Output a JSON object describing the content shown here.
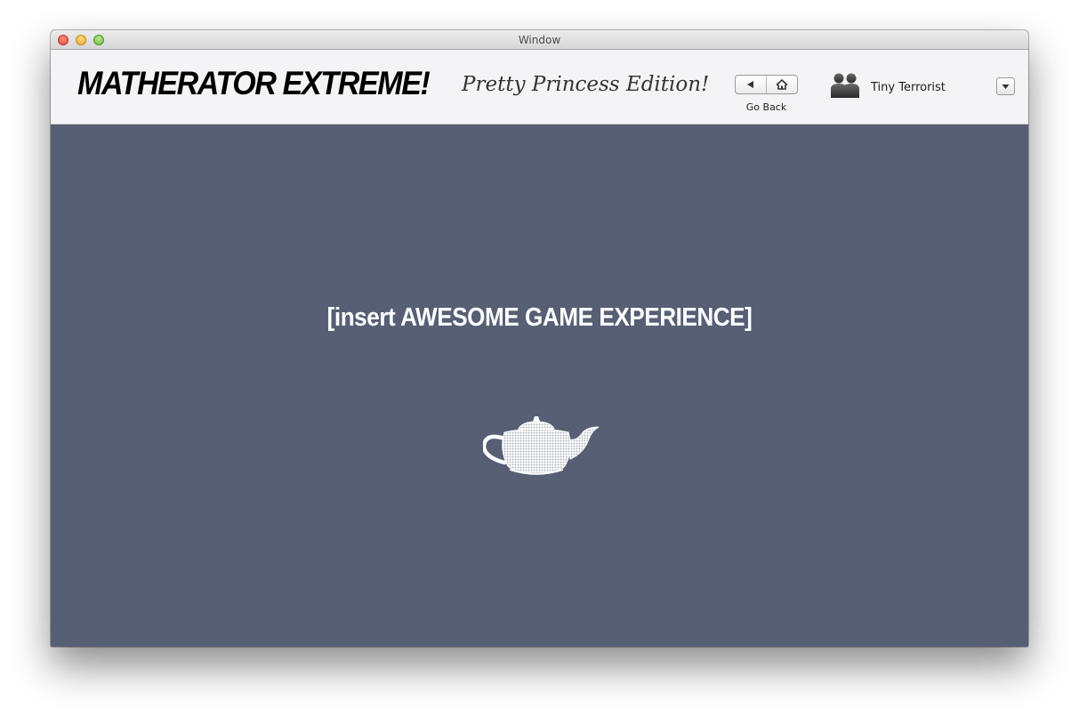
{
  "window": {
    "title": "Window"
  },
  "toolbar": {
    "app_title": "MATHERATOR EXTREME!",
    "app_subtitle": "Pretty Princess Edition!",
    "go_back_label": "Go Back",
    "username": "Tiny Terrorist"
  },
  "icons": {
    "back": "back-triangle-icon",
    "home": "home-icon",
    "avatar": "users-group-icon",
    "menu": "chevron-down-icon",
    "game": "teapot-wireframe-icon"
  },
  "game": {
    "placeholder_text": "[insert AWESOME GAME EXPERIENCE]"
  },
  "colors": {
    "game_background": "#565f74",
    "toolbar_background": "#f4f4f6",
    "text_on_game": "#ffffff"
  }
}
